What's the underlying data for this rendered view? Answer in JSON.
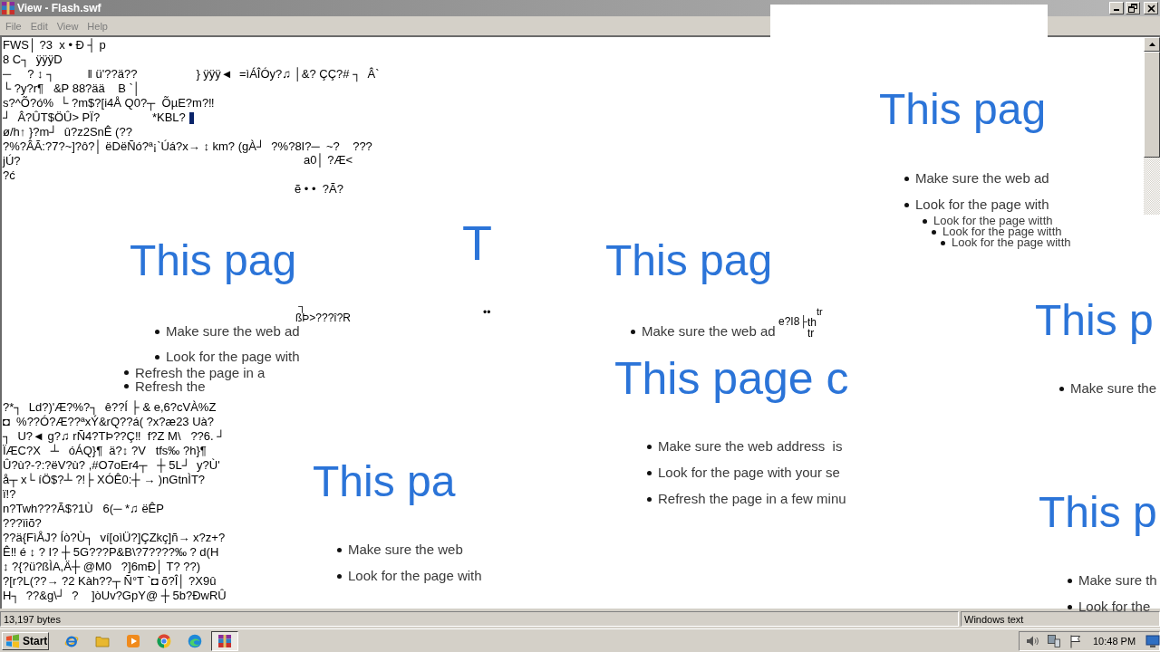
{
  "window": {
    "title": "View - Flash.swf"
  },
  "menu": [
    {
      "label": "File"
    },
    {
      "label": "Edit"
    },
    {
      "label": "View"
    },
    {
      "label": "Help"
    }
  ],
  "file_text": {
    "upper_lines": [
      "FWS│ ?3  x • Ð ┤ p",
      "8 C┐  ÿÿÿD",
      "─     ? ↕ ┐          ‖ ü'??ä??                  } ÿÿÿ◄  =ìÁÎÓy?♫ │&? ÇÇ?# ┐  Â`",
      "└ ?y?r¶   &P 88?ää    B `│",
      "s?^Õ?ó%  └ ?m$?[i4Å Q0?┬  ÕµE?m?‼",
      "┘  Â?ÛT$ÖÛ> PÏ?                *KBL?",
      "ø/h↑ }?m┘  û?z2SnÊ (??",
      "?%?ÂÃ:?7?~]?ô?│ ëDëÑó?ª¡`Úá?x→ ↕ km? (gÀ┘  ?%?8I?─  ~?    ???",
      "jÚ?",
      "?ć"
    ],
    "lower_lines": [
      "?*┐  Ld?)'Æ?%?┐  ê??Í ├ & e,6?cVÀ%Z",
      "◘  %??Ó?Æ??ªxÝ&rQ??á( ?x?æ23 Uà?",
      "┐  U?◄ g?♫ rÑ4?TÞ??Ç‼  f?Z M\\   ??6. ┘",
      "ÏÆC?X   ┴   óÁQ}¶  ä?↕ ?V   tfs‰ ?h}¶",
      "Û?ù?-?:?ëV?ù? ,#O7oEr4┬   ┼ 5L┘  y?Ù'",
      "å┬ x└ íÖ$?┴ ?!├ XÓÊ0:┼ → )nGtnÌT?",
      "ï!?",
      "n?Twh???Ã$?1Ù   6(─ *♫ ëÊP",
      "???ïiõ?",
      "??ä{FìÅJ? Íò?Ù┐  ví[oìÜ?]ÇZkç]ñ→ x?z+?",
      "Ê‼ é ↕ ? I? ┼ 5G???P&B\\?7????‰ ? d(H",
      "↕ ?{?ü?ßÌA,Ä┼ @M0   ?]6mÐ│ T? ??)",
      "?[r?L(??→ ?2 Kàh??┬ Ñ°T `◘ õ?Î│ ?X9û",
      "H┐  ??&g\\┘  ?    ]òUv?GpY@ ┼ 5b?ÐwRÛ"
    ]
  },
  "error_fragments": [
    {
      "heading": "This pag",
      "bullets": [
        "Make sure the web ad",
        "Look for the page with"
      ]
    },
    {
      "bullets": [
        "Look for the page witth",
        "Look for the page witth",
        "Look for the page witth"
      ]
    },
    {
      "heading": "This pag",
      "bullets": [
        "Make sure the web ad",
        "Look for the page with",
        "Refresh the page in a",
        "Refresh the"
      ]
    },
    {
      "heading": "T"
    },
    {
      "heading": "This pag",
      "bullets": [
        "Make sure the web ad"
      ]
    },
    {
      "heading": "This p",
      "bullets": [
        "Make sure the"
      ]
    },
    {
      "heading": "This page c",
      "bullets": [
        "Make sure the web address  is",
        "Look for the page with your se",
        "Refresh the page in a few minu"
      ]
    },
    {
      "heading": "This pa",
      "bullets": [
        "Make sure the web",
        "Look for the page with"
      ]
    },
    {
      "heading": "This p",
      "bullets": [
        "Make sure th",
        "Look for the"
      ]
    }
  ],
  "stray_text": [
    "a0│ ?Æ<",
    "ẽ • •  ?Ã?",
    "┐",
    "ßÞ>???î?R",
    "••",
    "e?I8├",
    "th",
    "tr",
    "tr"
  ],
  "status_bar": {
    "size": "13,197 bytes",
    "encoding": "Windows text"
  },
  "taskbar": {
    "start": "Start",
    "clock": "10:48 PM"
  }
}
